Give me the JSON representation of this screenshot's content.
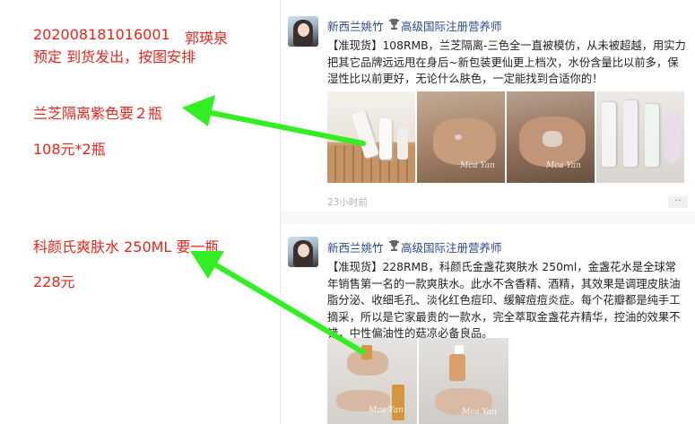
{
  "annotations": {
    "order_id": "202008181016001",
    "customer": "郭瑛泉",
    "instruction": "预定 到货发出，按图安排",
    "item1_name": "兰芝隔离紫色要２瓶",
    "item1_price": "108元*2瓶",
    "item2_name": "科颜氏爽肤水 250ML 要一瓶",
    "item2_price": "228元",
    "text_color": "#e8251b",
    "arrow_color": "#33ee22"
  },
  "posts": [
    {
      "author": "新西兰姚竹",
      "badge_icon": "trophy-icon",
      "author_title": "高级国际注册营养师",
      "text": "【准现货】108RMB，兰芝隔离-三色全一直被模仿，从未被超越，用实力把其它品牌远远甩在身后~新包装更仙更上档次，水份含量比以前多，保湿性比以前更好，无论什么肤色，一定能找到合适你的！",
      "time": "23小时前",
      "more": "··",
      "watermark": "Mca Yan"
    },
    {
      "author": "新西兰姚竹",
      "badge_icon": "trophy-icon",
      "author_title": "高级国际注册营养师",
      "text": "【准现货】228RMB，科颜氏金盏花爽肤水 250ml，金盏花水是全球常年销售第一名的一款爽肤水。此水不含香精、酒精，其效果是调理皮肤油脂分泌、收细毛孔、淡化红色痘印、缓解痘痘炎症。每个花瓣都是纯手工摘采，所以是它家最贵的一款水，完全萃取金盏花卉精华，控油的效果不错，中性偏油性的菇凉必备良品。",
      "watermark": "Mca Yan"
    }
  ]
}
